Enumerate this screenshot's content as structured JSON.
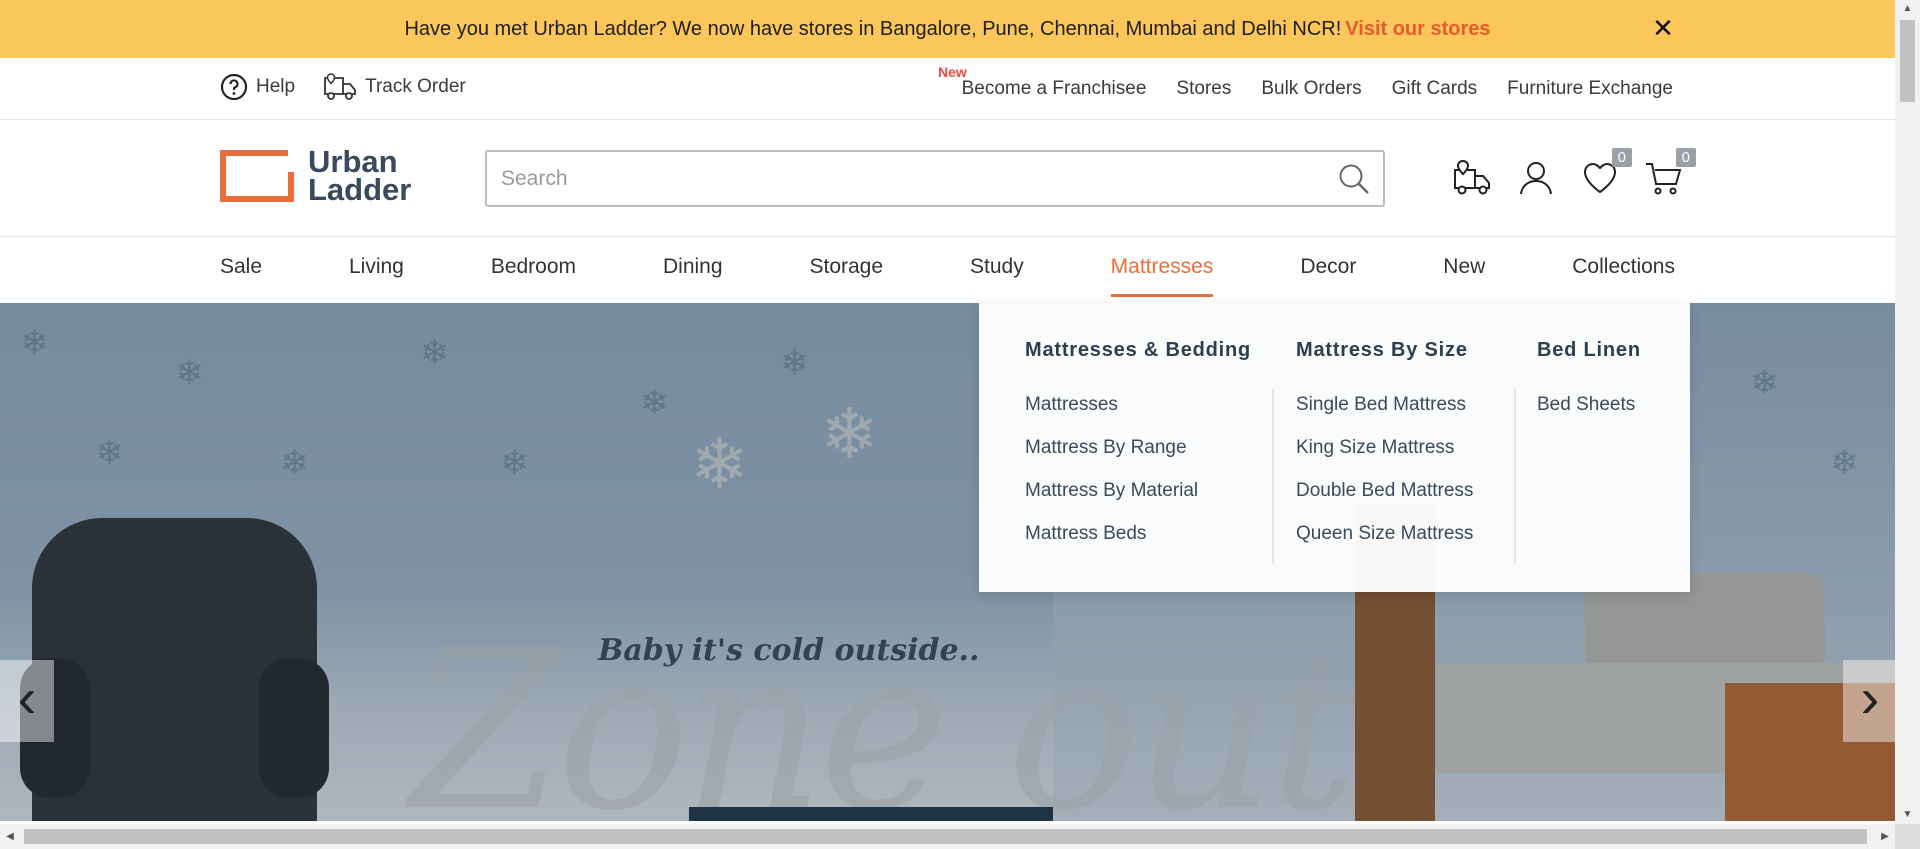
{
  "announcement": {
    "text": "Have you met Urban Ladder? We now have stores in Bangalore, Pune, Chennai, Mumbai and Delhi NCR!",
    "link": "Visit our stores",
    "close": "✕"
  },
  "utility": {
    "help": "Help",
    "track_order": "Track Order",
    "new_tag": "New",
    "links": [
      "Become a Franchisee",
      "Stores",
      "Bulk Orders",
      "Gift Cards",
      "Furniture Exchange"
    ]
  },
  "header": {
    "logo_line1": "Urban",
    "logo_line2": "Ladder",
    "search_placeholder": "Search",
    "wishlist_count": "0",
    "cart_count": "0"
  },
  "nav": {
    "items": [
      "Sale",
      "Living",
      "Bedroom",
      "Dining",
      "Storage",
      "Study",
      "Mattresses",
      "Decor",
      "New",
      "Collections"
    ],
    "active": "Mattresses"
  },
  "mega_menu": {
    "columns": [
      {
        "heading": "Mattresses & Bedding",
        "links": [
          "Mattresses",
          "Mattress By Range",
          "Mattress By Material",
          "Mattress Beds"
        ]
      },
      {
        "heading": "Mattress By Size",
        "links": [
          "Single Bed Mattress",
          "King Size Mattress",
          "Double Bed Mattress",
          "Queen Size Mattress"
        ]
      },
      {
        "heading": "Bed Linen",
        "links": [
          "Bed Sheets"
        ]
      }
    ]
  },
  "hero": {
    "tagline": "Baby it's cold outside..",
    "script": "Zone out",
    "prev": "‹",
    "next": "›"
  },
  "colors": {
    "accent": "#e96e3a",
    "banner": "#fbc65a",
    "text": "#2f3b4a"
  }
}
